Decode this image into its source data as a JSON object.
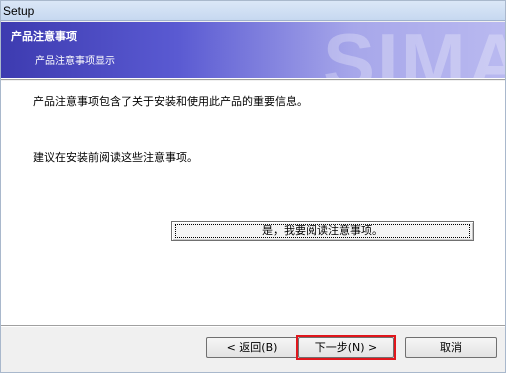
{
  "window": {
    "title": "Setup"
  },
  "banner": {
    "title": "产品注意事项",
    "subtitle": "产品注意事项显示",
    "watermark": "SIMA"
  },
  "content": {
    "line1": "产品注意事项包含了关于安装和使用此产品的重要信息。",
    "line2": "建议在安装前阅读这些注意事项。",
    "read_button": "是，我要阅读注意事项。"
  },
  "footer": {
    "back_label": "< 返回(B)",
    "next_label": "下一步(N) >",
    "cancel_label": "取消"
  },
  "colors": {
    "banner_start": "#3d3bb0",
    "banner_end": "#b9b9f0",
    "highlight": "#e0161c"
  }
}
